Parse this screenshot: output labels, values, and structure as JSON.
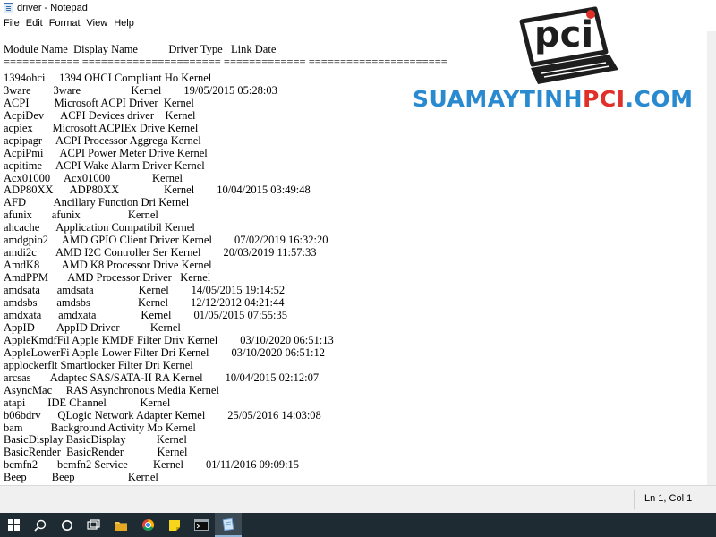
{
  "window": {
    "title": "driver - Notepad"
  },
  "menu": [
    "File",
    "Edit",
    "Format",
    "View",
    "Help"
  ],
  "editor": {
    "lines": [
      "Module Name  Display Name           Driver Type   Link Date",
      "============ ====================== ============= ======================",
      "1394ohci     1394 OHCI Compliant Ho Kernel",
      "3ware        3ware                  Kernel        19/05/2015 05:28:03",
      "ACPI         Microsoft ACPI Driver  Kernel",
      "AcpiDev      ACPI Devices driver    Kernel",
      "acpiex       Microsoft ACPIEx Drive Kernel",
      "acpipagr     ACPI Processor Aggrega Kernel",
      "AcpiPmi      ACPI Power Meter Drive Kernel",
      "acpitime     ACPI Wake Alarm Driver Kernel",
      "Acx01000     Acx01000               Kernel",
      "ADP80XX      ADP80XX                Kernel        10/04/2015 03:49:48",
      "AFD          Ancillary Function Dri Kernel",
      "afunix       afunix                 Kernel",
      "ahcache      Application Compatibil Kernel",
      "amdgpio2     AMD GPIO Client Driver Kernel        07/02/2019 16:32:20",
      "amdi2c       AMD I2C Controller Ser Kernel        20/03/2019 11:57:33",
      "AmdK8        AMD K8 Processor Drive Kernel",
      "AmdPPM       AMD Processor Driver   Kernel",
      "amdsata      amdsata                Kernel        14/05/2015 19:14:52",
      "amdsbs       amdsbs                 Kernel        12/12/2012 04:21:44",
      "amdxata      amdxata                Kernel        01/05/2015 07:55:35",
      "AppID        AppID Driver           Kernel",
      "AppleKmdfFil Apple KMDF Filter Driv Kernel        03/10/2020 06:51:13",
      "AppleLowerFi Apple Lower Filter Dri Kernel        03/10/2020 06:51:12",
      "applockerflt Smartlocker Filter Dri Kernel",
      "arcsas       Adaptec SAS/SATA-II RA Kernel        10/04/2015 02:12:07",
      "AsyncMac     RAS Asynchronous Media Kernel",
      "atapi        IDE Channel            Kernel",
      "b06bdrv      QLogic Network Adapter Kernel        25/05/2016 14:03:08",
      "bam          Background Activity Mo Kernel",
      "BasicDisplay BasicDisplay           Kernel",
      "BasicRender  BasicRender            Kernel",
      "bcmfn2       bcmfn2 Service         Kernel        01/11/2016 09:09:15",
      "Beep         Beep                   Kernel"
    ]
  },
  "status": {
    "position": "Ln 1, Col 1"
  },
  "watermark": {
    "logo_text": "pci",
    "brand_blue": "SUAMAYTINH",
    "brand_red": "PCI",
    "brand_suffix": ".COM",
    "blue_color": "#2a8ad0",
    "red_color": "#e0302a"
  },
  "taskbar": {
    "icons": [
      "windows-start-icon",
      "search-icon",
      "cortana-icon",
      "task-view-icon",
      "file-explorer-icon",
      "chrome-icon",
      "sticky-notes-icon",
      "terminal-icon",
      "notepad-icon"
    ]
  }
}
